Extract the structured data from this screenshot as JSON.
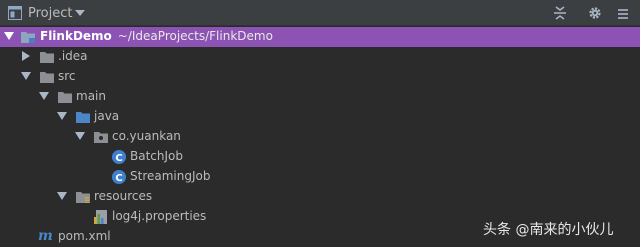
{
  "header": {
    "title": "Project",
    "icons": [
      "project-window-icon",
      "chevron-down-icon",
      "collapse-all-icon",
      "gear-icon",
      "hide-panel-icon"
    ]
  },
  "tree": {
    "root": {
      "name": "FlinkDemo",
      "path": "~/IdeaProjects/FlinkDemo"
    },
    "idea": ".idea",
    "src": "src",
    "main": "main",
    "java": "java",
    "package": "co.yuankan",
    "batch": "BatchJob",
    "streaming": "StreamingJob",
    "resources": "resources",
    "log4j": "log4j.properties",
    "pom": "pom.xml"
  },
  "watermark": "头条 @南来的小伙儿",
  "colors": {
    "selection": "#8d53b4",
    "background": "#2b2b2b",
    "header": "#3c3f41"
  }
}
